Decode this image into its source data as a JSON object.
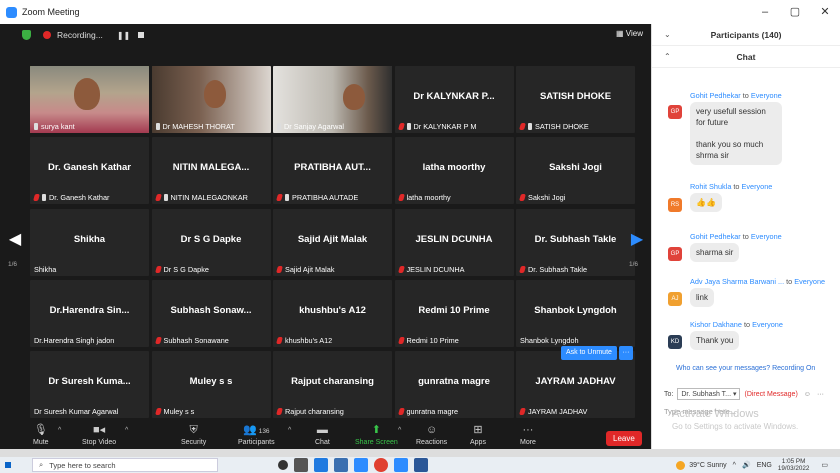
{
  "window": {
    "title": "Zoom Meeting",
    "minimize": "–",
    "maximize": "▢",
    "close": "✕"
  },
  "topbar": {
    "recording": "Recording...",
    "pause": "❚❚",
    "view": "▦ View"
  },
  "tiles": [
    {
      "name": "",
      "label": "surya kant",
      "video": "v1",
      "muted": false,
      "pinned": true
    },
    {
      "name": "",
      "label": "Dr MAHESH THORAT",
      "video": "v2",
      "muted": false,
      "pinned": true
    },
    {
      "name": "",
      "label": "Dr Sanjay Agarwal",
      "video": "v3",
      "muted": false,
      "pinned": true
    },
    {
      "name": "Dr KALYNKAR P...",
      "label": "Dr KALYNKAR P M",
      "muted": true,
      "pinned": true
    },
    {
      "name": "SATISH DHOKE",
      "label": "SATISH DHOKE",
      "muted": true,
      "pinned": true
    },
    {
      "name": "Dr. Ganesh Kathar",
      "label": "Dr. Ganesh Kathar",
      "muted": true,
      "pinned": true
    },
    {
      "name": "NITIN MALEGA...",
      "label": "NITIN MALEGAONKAR",
      "muted": true,
      "pinned": true
    },
    {
      "name": "PRATIBHA AUT...",
      "label": "PRATIBHA AUTADE",
      "muted": true,
      "pinned": true
    },
    {
      "name": "latha moorthy",
      "label": "latha moorthy",
      "muted": true,
      "pinned": false
    },
    {
      "name": "Sakshi Jogi",
      "label": "Sakshi Jogi",
      "muted": true,
      "pinned": false
    },
    {
      "name": "Shikha",
      "label": "Shikha",
      "muted": false,
      "pinned": false
    },
    {
      "name": "Dr S G Dapke",
      "label": "Dr S G Dapke",
      "muted": true,
      "pinned": false
    },
    {
      "name": "Sajid Ajit Malak",
      "label": "Sajid Ajit Malak",
      "muted": true,
      "pinned": false
    },
    {
      "name": "JESLIN DCUNHA",
      "label": "JESLIN DCUNHA",
      "muted": true,
      "pinned": false
    },
    {
      "name": "Dr. Subhash Takle",
      "label": "Dr. Subhash Takle",
      "muted": true,
      "pinned": false
    },
    {
      "name": "Dr.Harendra Sin...",
      "label": "Dr.Harendra Singh jadon",
      "muted": false,
      "pinned": false
    },
    {
      "name": "Subhash Sonaw...",
      "label": "Subhash Sonawane",
      "muted": true,
      "pinned": false
    },
    {
      "name": "khushbu's A12",
      "label": "khushbu's A12",
      "muted": true,
      "pinned": false
    },
    {
      "name": "Redmi 10 Prime",
      "label": "Redmi 10 Prime",
      "muted": true,
      "pinned": false
    },
    {
      "name": "Shanbok Lyngdoh",
      "label": "Shanbok Lyngdoh",
      "muted": false,
      "pinned": false
    },
    {
      "name": "Dr Suresh Kuma...",
      "label": "Dr Suresh Kumar Agarwal",
      "muted": false,
      "pinned": false
    },
    {
      "name": "Muley s s",
      "label": "Muley s s",
      "muted": true,
      "pinned": false
    },
    {
      "name": "Rajput charansing",
      "label": "Rajput charansing",
      "muted": true,
      "pinned": false
    },
    {
      "name": "gunratna magre",
      "label": "gunratna magre",
      "muted": true,
      "pinned": false
    },
    {
      "name": "JAYRAM JADHAV",
      "label": "JAYRAM JADHAV",
      "muted": true,
      "pinned": false
    }
  ],
  "pager": {
    "left": "1/6",
    "right": "1/6"
  },
  "ask_unmute": {
    "label": "Ask to Unmute",
    "more": "···"
  },
  "toolbar": {
    "mute": "Mute",
    "stop_video": "Stop Video",
    "security": "Security",
    "participants": "Participants",
    "participant_count": "136",
    "chat": "Chat",
    "share_screen": "Share Screen",
    "reactions": "Reactions",
    "apps": "Apps",
    "more": "More",
    "leave": "Leave"
  },
  "panel": {
    "participants_title": "Participants (140)",
    "chat_title": "Chat",
    "messages": [
      {
        "from": "Gohit Pedhekar",
        "to": "Everyone",
        "initials": "GP",
        "color": "#e0433a",
        "text": "very usefull session for future\n\nthank you so much shrma sir"
      },
      {
        "from": "Rohit  Shukla",
        "to": "Everyone",
        "initials": "RS",
        "color": "#f07a2a",
        "text": "👍👍"
      },
      {
        "from": "Gohit Pedhekar",
        "to": "Everyone",
        "initials": "GP",
        "color": "#e0433a",
        "text": "sharma sir"
      },
      {
        "from": "Adv Jaya Sharma Barwani ...",
        "to": "Everyone",
        "initials": "AJ",
        "color": "#f0a030",
        "text": "link"
      },
      {
        "from": "Kishor Dakhane",
        "to": "Everyone",
        "initials": "KD",
        "color": "#2b3d55",
        "text": "Thank you"
      }
    ],
    "notice": "Who can see your messages? Recording On",
    "to_label": "To:",
    "to_value": "Dr. Subhash T... ▾",
    "direct": "(Direct Message)",
    "type_placeholder": "Type message here...",
    "activate_line1": "Activate Windows",
    "activate_line2": "Go to Settings to activate Windows."
  },
  "taskbar": {
    "search_placeholder": "Type here to search",
    "weather": "39°C  Sunny",
    "lang": "ENG",
    "time": "1:05 PM",
    "date": "19/03/2022"
  }
}
